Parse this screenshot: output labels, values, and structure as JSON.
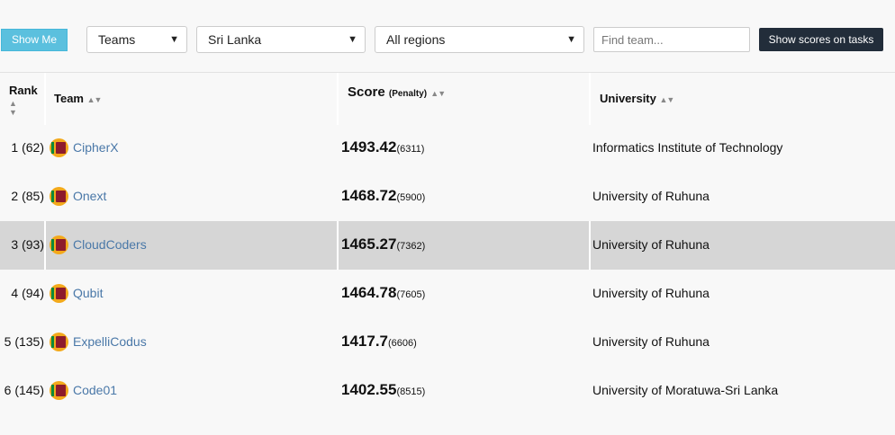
{
  "toolbar": {
    "show_me": "Show Me",
    "view_select": "Teams",
    "country_select": "Sri Lanka",
    "region_select": "All regions",
    "search_placeholder": "Find team...",
    "show_scores": "Show scores on tasks"
  },
  "columns": {
    "rank": "Rank",
    "team": "Team",
    "score": "Score",
    "penalty": "(Penalty)",
    "university": "University"
  },
  "rows": [
    {
      "rank": "1 (62)",
      "team": "CipherX",
      "score": "1493.42",
      "penalty": "(6311)",
      "university": "Informatics Institute of Technology"
    },
    {
      "rank": "2 (85)",
      "team": "Onext",
      "score": "1468.72",
      "penalty": "(5900)",
      "university": "University of Ruhuna"
    },
    {
      "rank": "3 (93)",
      "team": "CloudCoders",
      "score": "1465.27",
      "penalty": "(7362)",
      "university": "University of Ruhuna"
    },
    {
      "rank": "4 (94)",
      "team": "Qubit",
      "score": "1464.78",
      "penalty": "(7605)",
      "university": "University of Ruhuna"
    },
    {
      "rank": "5 (135)",
      "team": "ExpelliCodus",
      "score": "1417.7",
      "penalty": "(6606)",
      "university": "University of Ruhuna"
    },
    {
      "rank": "6 (145)",
      "team": "Code01",
      "score": "1402.55",
      "penalty": "(8515)",
      "university": "University of Moratuwa-Sri Lanka"
    }
  ],
  "highlight_color": "#d6d6d6",
  "link_color": "#4a78a8",
  "accent_button_color": "#5bc0de",
  "dark_button_color": "#222d3a"
}
